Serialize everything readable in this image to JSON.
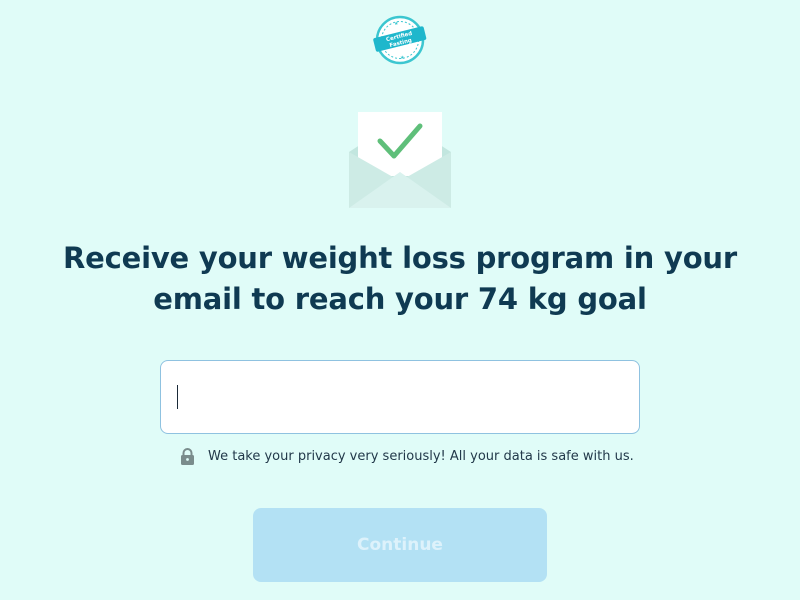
{
  "badge": {
    "line1": "Certified",
    "line2": "Fasting",
    "icon": "certified-fasting-badge-icon"
  },
  "illustration": {
    "icon": "envelope-checkmark-icon",
    "colors": {
      "envelope": "#bfe5dd",
      "check": "#5fbf7a"
    }
  },
  "headline": "Receive your weight loss program in your email to reach your 74 kg goal",
  "email_input": {
    "value": "",
    "placeholder": ""
  },
  "privacy": {
    "icon": "lock-icon",
    "text": "We take your privacy very seriously! All your data is safe with us."
  },
  "continue_button": {
    "label": "Continue",
    "enabled": false
  },
  "colors": {
    "background": "#e0fcf8",
    "heading": "#0f3a52",
    "button_disabled": "#b3e1f4",
    "input_border": "#8fc2e0"
  }
}
